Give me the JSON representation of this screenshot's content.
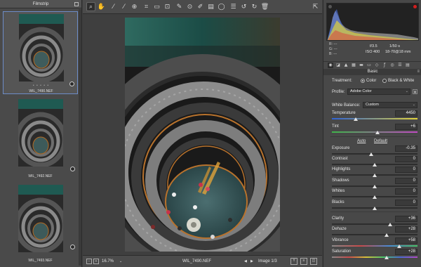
{
  "filmstrip": {
    "title": "Filmstrip",
    "items": [
      {
        "filename": "WIL_7490.NEF",
        "rating": "• • • • •",
        "selected": true
      },
      {
        "filename": "WIL_7492.NEF",
        "selected": false
      },
      {
        "filename": "WIL_7493.NEF",
        "selected": false
      }
    ]
  },
  "toolbar": {
    "tools": [
      "zoom-icon",
      "hand-icon",
      "white-balance-icon",
      "color-sampler-icon",
      "targeted-adjustment-icon",
      "crop-icon",
      "straighten-icon",
      "transform-icon",
      "spot-removal-icon",
      "red-eye-icon",
      "adjustment-brush-icon",
      "graduated-filter-icon",
      "radial-filter-icon",
      "preferences-icon",
      "rotate-left-icon",
      "rotate-right-icon",
      "trash-icon"
    ],
    "open_full_screen": "full-screen-icon"
  },
  "statusbar": {
    "zoom": "16.7%",
    "filename": "WIL_7490.NEF",
    "image_counter": "Image 1/3",
    "prev_icon": "◀",
    "next_icon": "▶"
  },
  "histogram": {
    "colors": {
      "red": "#d8463f",
      "green": "#5bbf4b",
      "blue": "#4b6fe0",
      "yellow": "#e0d23c",
      "luminance": "#bdbdbd"
    }
  },
  "info": {
    "r_label": "R:",
    "g_label": "G:",
    "b_label": "B:",
    "r_value": "---",
    "g_value": "---",
    "b_value": "---",
    "aperture": "f/3.5",
    "shutter": "1/50 s",
    "iso": "ISO 400",
    "lens": "18-70@18 mm"
  },
  "panel": {
    "section_title": "Basic",
    "treatment_label": "Treatment:",
    "treatment_color": "Color",
    "treatment_bw": "Black & White",
    "profile_label": "Profile:",
    "profile_value": "Adobe Color",
    "white_balance_label": "White Balance:",
    "white_balance_value": "Custom",
    "auto_label": "Auto",
    "default_label": "Default"
  },
  "sliders": [
    {
      "label": "Temperature",
      "value": "4450",
      "pos": 0.28,
      "track": "temp"
    },
    {
      "label": "Tint",
      "value": "+6",
      "pos": 0.53,
      "track": "tint"
    },
    {
      "label": "Exposure",
      "value": "-0.35",
      "pos": 0.46,
      "track": "plain"
    },
    {
      "label": "Contrast",
      "value": "0",
      "pos": 0.5,
      "track": "plain"
    },
    {
      "label": "Highlights",
      "value": "0",
      "pos": 0.5,
      "track": "plain"
    },
    {
      "label": "Shadows",
      "value": "0",
      "pos": 0.5,
      "track": "plain"
    },
    {
      "label": "Whites",
      "value": "0",
      "pos": 0.5,
      "track": "plain"
    },
    {
      "label": "Blacks",
      "value": "0",
      "pos": 0.5,
      "track": "plain"
    },
    {
      "label": "Clarity",
      "value": "+36",
      "pos": 0.68,
      "track": "plain"
    },
    {
      "label": "Dehaze",
      "value": "+28",
      "pos": 0.64,
      "track": "plain"
    },
    {
      "label": "Vibrance",
      "value": "+58",
      "pos": 0.79,
      "track": "vib"
    },
    {
      "label": "Saturation",
      "value": "+28",
      "pos": 0.64,
      "track": "sat"
    }
  ]
}
